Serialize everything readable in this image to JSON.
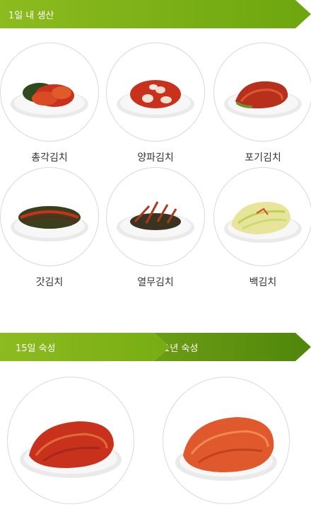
{
  "banners": {
    "production": "1일 내 생산",
    "aging_15days": "15일 숙성",
    "aging_1year": "1년 숙성"
  },
  "products": [
    {
      "label": "총각김치",
      "icon": "chonggak-kimchi-plate-image"
    },
    {
      "label": "양파김치",
      "icon": "onion-kimchi-plate-image"
    },
    {
      "label": "포기김치",
      "icon": "napa-cabbage-kimchi-plate-image"
    },
    {
      "label": "갓김치",
      "icon": "mustard-leaf-kimchi-plate-image"
    },
    {
      "label": "열무김치",
      "icon": "young-radish-kimchi-plate-image"
    },
    {
      "label": "백김치",
      "icon": "white-kimchi-plate-image"
    }
  ],
  "colors": {
    "banner_green": "#7ab317",
    "banner_dark_green": "#5a8f0e",
    "kimchi_red": "#c8321c"
  }
}
